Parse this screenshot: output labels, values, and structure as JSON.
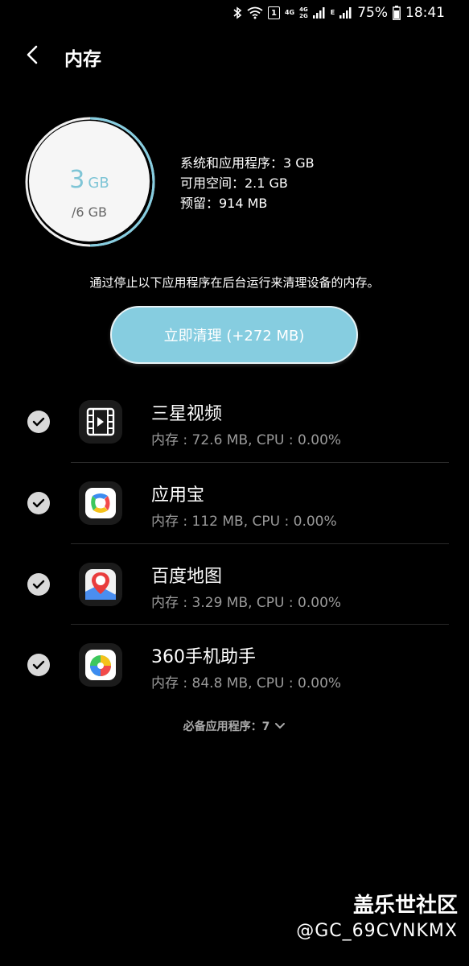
{
  "status_bar": {
    "battery": "75%",
    "time": "18:41",
    "net_4g": "4G",
    "net_4g2": "4G",
    "net_2g": "2G",
    "sim_badge": "1",
    "net_e": "E"
  },
  "header": {
    "title": "内存"
  },
  "memory": {
    "used_value": "3",
    "used_unit": "GB",
    "total": "/6 GB",
    "stats": [
      "系统和应用程序：3 GB",
      "可用空间：2.1 GB",
      "预留：914 MB"
    ]
  },
  "description": "通过停止以下应用程序在后台运行来清理设备的内存。",
  "clean_button": "立即清理 (+272 MB)",
  "apps": [
    {
      "name": "三星视频",
      "usage": "内存 : 72.6 MB, CPU : 0.00%",
      "icon": "video-icon"
    },
    {
      "name": "应用宝",
      "usage": "内存 : 112 MB, CPU : 0.00%",
      "icon": "yingyongbao-icon"
    },
    {
      "name": "百度地图",
      "usage": "内存 : 3.29 MB, CPU : 0.00%",
      "icon": "baidu-map-icon"
    },
    {
      "name": "360手机助手",
      "usage": "内存 : 84.8 MB, CPU : 0.00%",
      "icon": "360-assistant-icon"
    }
  ],
  "essential_apps": "必备应用程序：7",
  "watermark": {
    "title": "盖乐世社区",
    "user": "@GC_69CVNKMX"
  },
  "colors": {
    "accent": "#86cde0",
    "circle_text": "#7fc5d6"
  }
}
